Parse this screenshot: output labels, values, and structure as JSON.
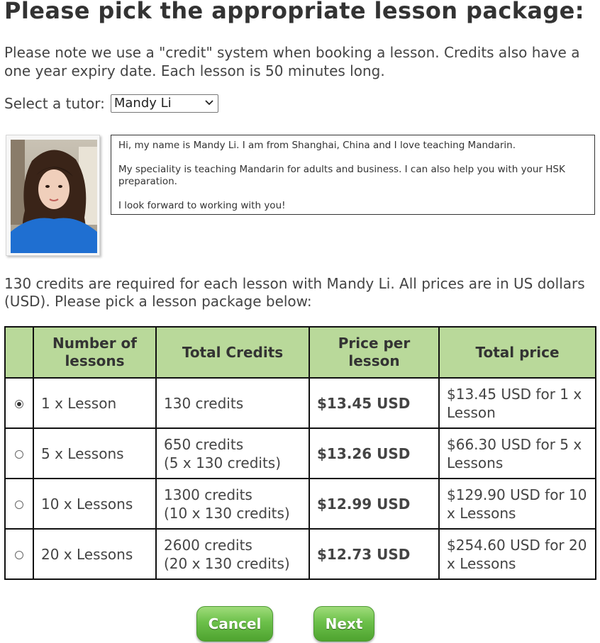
{
  "page": {
    "title": "Please pick the appropriate lesson package:",
    "note": "Please note we use a \"credit\" system when booking a lesson. Credits also have a one year expiry date. Each lesson is 50 minutes long."
  },
  "tutor": {
    "label": "Select a tutor:",
    "selected": "Mandy Li",
    "bio": [
      "Hi, my name is Mandy Li. I am from Shanghai, China and I love teaching Mandarin.",
      "My speciality is teaching Mandarin for adults and business. I can also help you with your HSK preparation.",
      "I look forward to working with you!"
    ],
    "credits_note": "130 credits are required for each lesson with Mandy Li. All prices are in US dollars (USD). Please pick a lesson package below:"
  },
  "table": {
    "headers": [
      "",
      "Number of lessons",
      "Total Credits",
      "Price per lesson",
      "Total price"
    ],
    "rows": [
      {
        "selected": true,
        "lessons": "1 x Lesson",
        "credits": "130 credits",
        "credits_detail": "",
        "price": "$13.45 USD",
        "total": "$13.45 USD for 1 x Lesson"
      },
      {
        "selected": false,
        "lessons": "5 x Lessons",
        "credits": "650 credits",
        "credits_detail": "(5 x 130 credits)",
        "price": "$13.26 USD",
        "total": "$66.30 USD for 5 x Lessons"
      },
      {
        "selected": false,
        "lessons": "10 x Lessons",
        "credits": "1300 credits",
        "credits_detail": "(10 x 130 credits)",
        "price": "$12.99 USD",
        "total": "$129.90 USD for 10 x Lessons"
      },
      {
        "selected": false,
        "lessons": "20 x Lessons",
        "credits": "2600 credits",
        "credits_detail": "(20 x 130 credits)",
        "price": "$12.73 USD",
        "total": "$254.60 USD for 20 x Lessons"
      }
    ]
  },
  "buttons": {
    "cancel": "Cancel",
    "next": "Next"
  },
  "colors": {
    "header_bg": "#b9d99a",
    "button_green": "#6cc04a",
    "text": "#444444"
  }
}
